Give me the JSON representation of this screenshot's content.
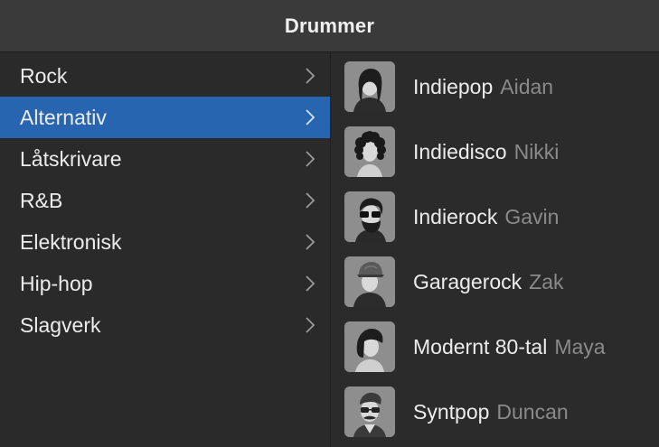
{
  "window": {
    "title": "Drummer"
  },
  "categories": [
    {
      "label": "Rock",
      "selected": false
    },
    {
      "label": "Alternativ",
      "selected": true
    },
    {
      "label": "Låtskrivare",
      "selected": false
    },
    {
      "label": "R&B",
      "selected": false
    },
    {
      "label": "Elektronisk",
      "selected": false
    },
    {
      "label": "Hip-hop",
      "selected": false
    },
    {
      "label": "Slagverk",
      "selected": false
    }
  ],
  "drummers": [
    {
      "style": "Indiepop",
      "name": "Aidan",
      "avatar": "avatar-long-hair"
    },
    {
      "style": "Indiedisco",
      "name": "Nikki",
      "avatar": "avatar-curly-hair"
    },
    {
      "style": "Indierock",
      "name": "Gavin",
      "avatar": "avatar-sunglasses-beard"
    },
    {
      "style": "Garagerock",
      "name": "Zak",
      "avatar": "avatar-cap"
    },
    {
      "style": "Modernt 80-tal",
      "name": "Maya",
      "avatar": "avatar-side-swept-hair"
    },
    {
      "style": "Syntpop",
      "name": "Duncan",
      "avatar": "avatar-glasses-mustache"
    }
  ],
  "colors": {
    "selection": "#2865b0",
    "panel": "#2a2a2a",
    "titlebar": "#3a3a3a",
    "primary_text": "#ececec",
    "secondary_text": "#8a8a8a",
    "chevron": "#9a9a9a"
  }
}
